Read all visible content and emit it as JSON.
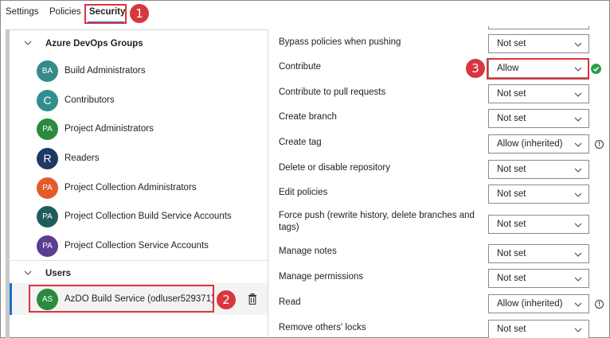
{
  "tabs": [
    {
      "label": "Settings"
    },
    {
      "label": "Policies"
    },
    {
      "label": "Security"
    }
  ],
  "callouts": [
    "1",
    "2",
    "3"
  ],
  "groups": {
    "azure_header": "Azure DevOps Groups",
    "members": [
      {
        "initials": "BA",
        "label": "Build Administrators",
        "color": "#368a8a"
      },
      {
        "initials": "C",
        "label": "Contributors",
        "color": "#2f8f8f"
      },
      {
        "initials": "PA",
        "label": "Project Administrators",
        "color": "#2b8a3e"
      },
      {
        "initials": "R",
        "label": "Readers",
        "color": "#1f3864"
      },
      {
        "initials": "PA",
        "label": "Project Collection Administrators",
        "color": "#e35a2b"
      },
      {
        "initials": "PA",
        "label": "Project Collection Build Service Accounts",
        "color": "#1f5c5c"
      },
      {
        "initials": "PA",
        "label": "Project Collection Service Accounts",
        "color": "#5c3d91"
      }
    ],
    "users_header": "Users",
    "user": {
      "initials": "AS",
      "label": "AzDO Build Service (odluser529371)",
      "color": "#2b8a3e"
    }
  },
  "permissions": [
    {
      "label": "Bypass policies when pushing",
      "value": "Not set",
      "info": false
    },
    {
      "label": "Contribute",
      "value": "Allow",
      "info": false
    },
    {
      "label": "Contribute to pull requests",
      "value": "Not set",
      "info": false
    },
    {
      "label": "Create branch",
      "value": "Not set",
      "info": false
    },
    {
      "label": "Create tag",
      "value": "Allow (inherited)",
      "info": true
    },
    {
      "label": "Delete or disable repository",
      "value": "Not set",
      "info": false
    },
    {
      "label": "Edit policies",
      "value": "Not set",
      "info": false
    },
    {
      "label": "Force push (rewrite history, delete branches and tags)",
      "value": "Not set",
      "info": false
    },
    {
      "label": "Manage notes",
      "value": "Not set",
      "info": false
    },
    {
      "label": "Manage permissions",
      "value": "Not set",
      "info": false
    },
    {
      "label": "Read",
      "value": "Allow (inherited)",
      "info": true
    },
    {
      "label": "Remove others' locks",
      "value": "Not set",
      "info": false
    }
  ],
  "colors": {
    "accent": "#1a73c7",
    "callout": "#d9363e",
    "success": "#2e9e44"
  }
}
